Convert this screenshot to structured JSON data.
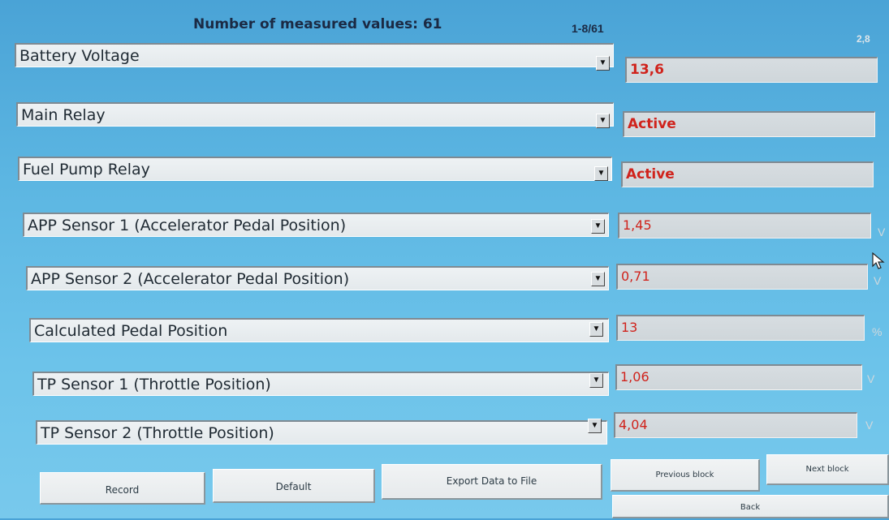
{
  "header": {
    "count_label": "Number of measured values: 61",
    "page_range": "1-8/61",
    "corner_value": "2,8"
  },
  "rows": [
    {
      "label": "Battery Voltage",
      "value": "13,6",
      "unit": ""
    },
    {
      "label": "Main Relay",
      "value": "Active",
      "unit": ""
    },
    {
      "label": "Fuel Pump Relay",
      "value": "Active",
      "unit": ""
    },
    {
      "label": "APP Sensor 1 (Accelerator Pedal Position)",
      "value": "1,45",
      "unit": "V"
    },
    {
      "label": "APP Sensor 2 (Accelerator Pedal Position)",
      "value": "0,71",
      "unit": "V"
    },
    {
      "label": "Calculated Pedal Position",
      "value": "13",
      "unit": "%"
    },
    {
      "label": "TP Sensor 1 (Throttle Position)",
      "value": "1,06",
      "unit": "V"
    },
    {
      "label": "TP Sensor 2 (Throttle Position)",
      "value": "4,04",
      "unit": "V"
    }
  ],
  "buttons": {
    "record": "Record",
    "default": "Default",
    "export": "Export Data to File",
    "previous_block": "Previous block",
    "next_block": "Next block",
    "back": "Back"
  },
  "icons": {
    "dropdown": "chevron-down-icon",
    "cursor": "mouse-pointer-icon"
  },
  "colors": {
    "value_text": "#d0231c",
    "background": "#5cb6e2"
  }
}
